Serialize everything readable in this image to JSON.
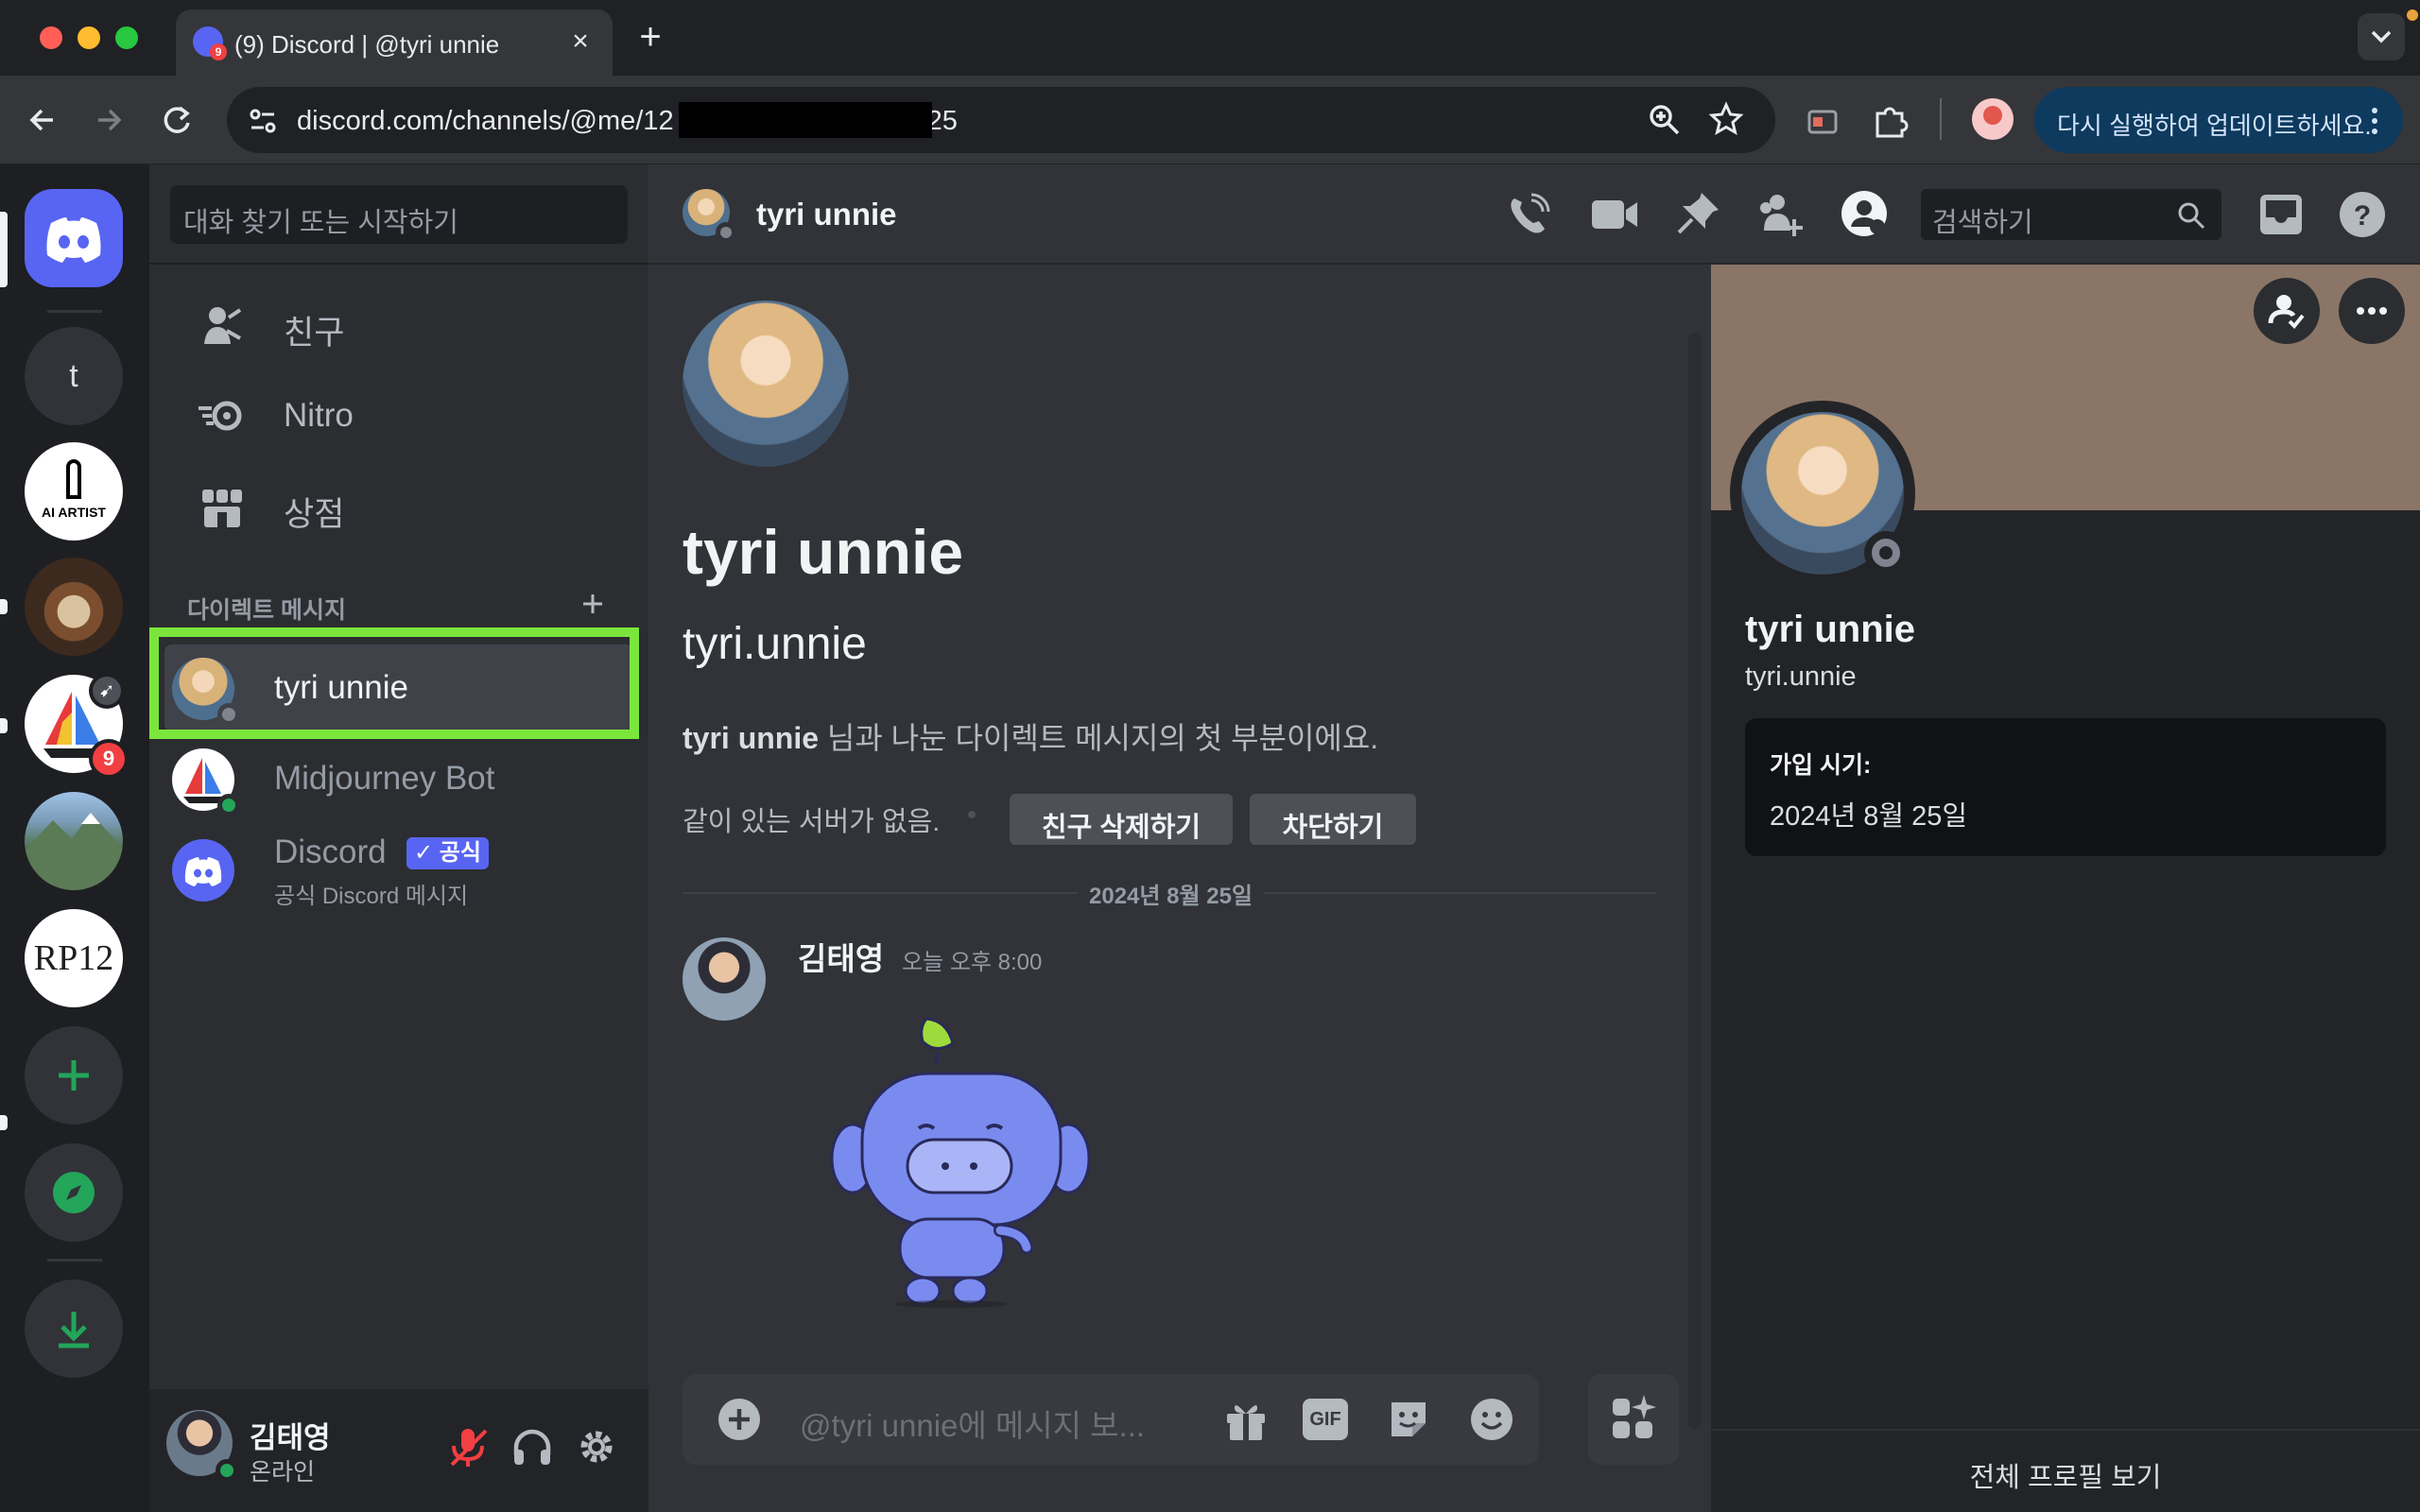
{
  "browser": {
    "tab_title": "(9) Discord | @tyri unnie",
    "tab_badge": "9",
    "url_prefix": "discord.com/channels/@me/12",
    "url_suffix": "25",
    "update_button": "다시 실행하여 업데이트하세요."
  },
  "guilds": {
    "t_initial": "t",
    "ai_artist_logo": "AI ARTIST",
    "rp12": "RP12",
    "mention_count": "9"
  },
  "dm_sidebar": {
    "search_placeholder": "대화 찾기 또는 시작하기",
    "nav": [
      {
        "label": "친구",
        "icon": "friends-icon"
      },
      {
        "label": "Nitro",
        "icon": "nitro-icon"
      },
      {
        "label": "상점",
        "icon": "shop-icon"
      }
    ],
    "section_title": "다이렉트 메시지",
    "dms": [
      {
        "name": "tyri unnie",
        "selected": true
      },
      {
        "name": "Midjourney Bot"
      },
      {
        "name": "Discord",
        "badge": "공식",
        "subtitle": "공식 Discord 메시지"
      }
    ]
  },
  "user_panel": {
    "name": "김태영",
    "status": "온라인"
  },
  "header": {
    "channel_name": "tyri unnie",
    "search_placeholder": "검색하기"
  },
  "main": {
    "display_name": "tyri unnie",
    "username": "tyri.unnie",
    "intro_name": "tyri unnie",
    "intro_rest": " 님과 나눈 다이렉트 메시지의 첫 부분이에요.",
    "no_mutual": "같이 있는 서버가 없음.",
    "remove_friend": "친구 삭제하기",
    "block": "차단하기",
    "date_divider": "2024년 8월 25일",
    "message": {
      "author": "김태영",
      "timestamp": "오늘 오후 8:00"
    },
    "composer_placeholder": "@tyri unnie에 메시지 보...",
    "gif_label": "GIF"
  },
  "profile": {
    "display_name": "tyri unnie",
    "username": "tyri.unnie",
    "member_since_label": "가입 시기:",
    "member_since_value": "2024년 8월 25일",
    "full_profile": "전체 프로필 보기",
    "banner_color": "#8a7566"
  },
  "colors": {
    "blurple": "#5865f2",
    "green": "#23a55a",
    "highlight": "#7ae63c",
    "red": "#f23f42"
  }
}
